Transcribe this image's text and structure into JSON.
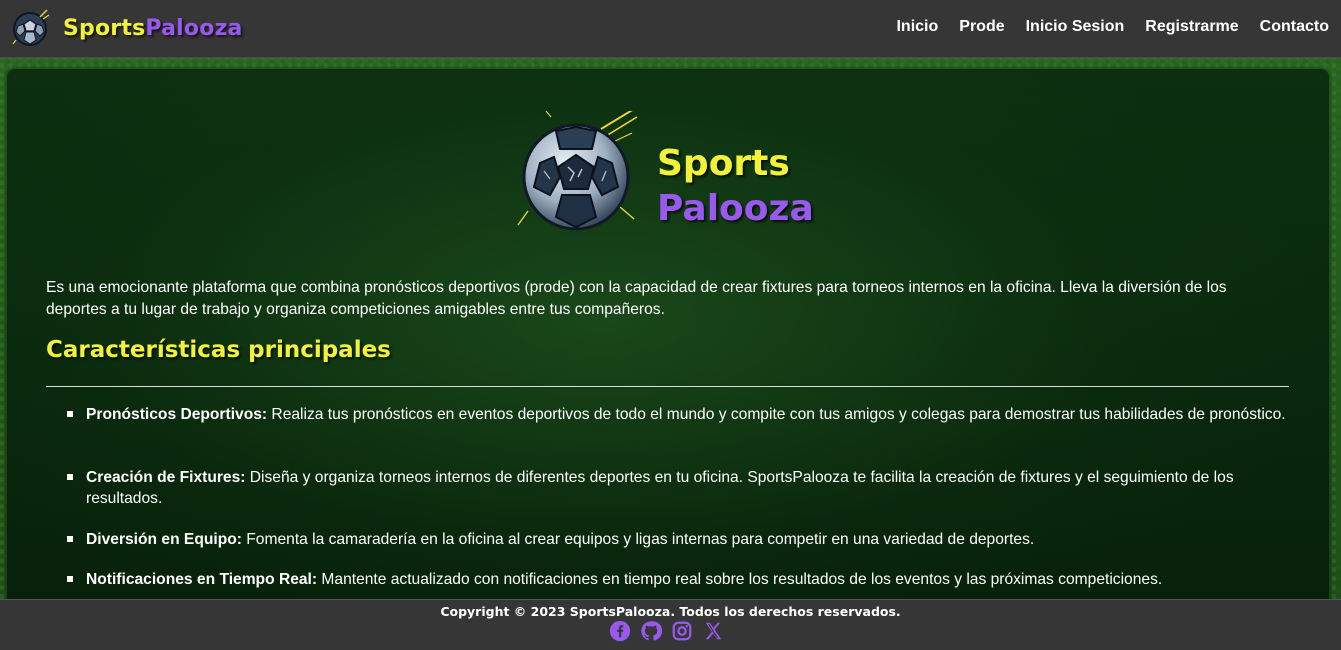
{
  "brand": {
    "name_part1": "Sports",
    "name_part2": "Palooza",
    "logo_icon": "soccer-ball-logo-icon",
    "yellow": "#f2f23a",
    "purple": "#9a59ee"
  },
  "nav": {
    "items": [
      {
        "label": "Inicio"
      },
      {
        "label": "Prode"
      },
      {
        "label": "Inicio Sesion"
      },
      {
        "label": "Registrarme"
      },
      {
        "label": "Contacto"
      }
    ]
  },
  "hero": {
    "title_line1": "Sports",
    "title_line2": "Palooza"
  },
  "main": {
    "description": "Es una emocionante plataforma que combina pronósticos deportivos (prode) con la capacidad de crear fixtures para torneos internos en la oficina. Lleva la diversión de los deportes a tu lugar de trabajo y organiza competiciones amigables entre tus compañeros.",
    "features_heading": "Características principales",
    "features": [
      {
        "title": "Pronósticos Deportivos:",
        "text": " Realiza tus pronósticos en eventos deportivos de todo el mundo y compite con tus amigos y colegas para demostrar tus habilidades de pronóstico."
      },
      {
        "title": "Creación de Fixtures:",
        "text": " Diseña y organiza torneos internos de diferentes deportes en tu oficina. SportsPalooza te facilita la creación de fixtures y el seguimiento de los resultados."
      },
      {
        "title": "Diversión en Equipo:",
        "text": " Fomenta la camaradería en la oficina al crear equipos y ligas internas para competir en una variedad de deportes."
      },
      {
        "title": "Notificaciones en Tiempo Real:",
        "text": " Mantente actualizado con notificaciones en tiempo real sobre los resultados de los eventos y las próximas competiciones."
      }
    ]
  },
  "footer": {
    "copyright": "Copyright © 2023 SportsPalooza. Todos los derechos reservados.",
    "social_icons": [
      "facebook-icon",
      "github-icon",
      "instagram-icon",
      "x-icon"
    ],
    "icon_color": "#9a59ee"
  }
}
